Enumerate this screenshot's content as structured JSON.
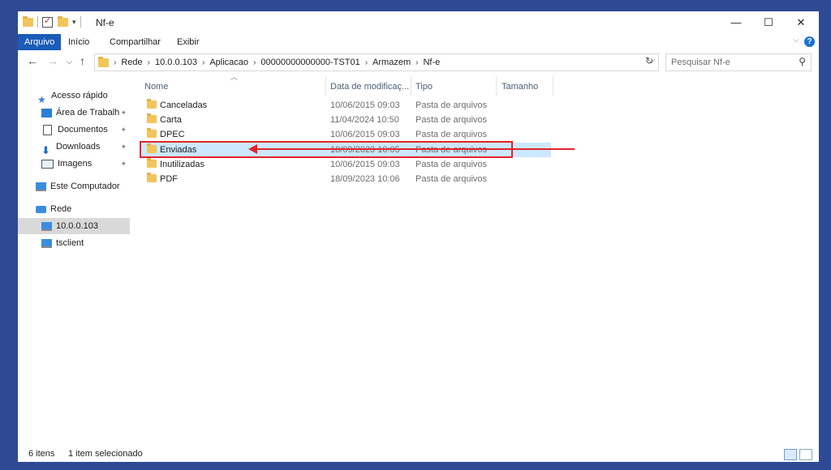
{
  "window": {
    "title": "Nf-e",
    "controls": {
      "minimize": "—",
      "maximize": "☐",
      "close": "✕"
    }
  },
  "ribbon": {
    "tabs": [
      "Arquivo",
      "Início",
      "Compartilhar",
      "Exibir"
    ]
  },
  "address": {
    "breadcrumbs": [
      "Rede",
      "10.0.0.103",
      "Aplicacao",
      "00000000000000-TST01",
      "Armazem",
      "Nf-e"
    ]
  },
  "search": {
    "placeholder": "Pesquisar Nf-e"
  },
  "sidebar": {
    "items": [
      {
        "label": "Acesso rápido",
        "icon": "star-icon"
      },
      {
        "label": "Área de Trabalho",
        "icon": "desktop-icon",
        "pinned": true
      },
      {
        "label": "Documentos",
        "icon": "document-icon",
        "pinned": true
      },
      {
        "label": "Downloads",
        "icon": "download-icon",
        "pinned": true
      },
      {
        "label": "Imagens",
        "icon": "image-icon",
        "pinned": true
      },
      {
        "label": "Este Computador",
        "icon": "computer-icon"
      },
      {
        "label": "Rede",
        "icon": "network-icon"
      },
      {
        "label": "10.0.0.103",
        "icon": "monitor-icon",
        "selected": true
      },
      {
        "label": "tsclient",
        "icon": "monitor-icon"
      }
    ]
  },
  "columns": [
    "Nome",
    "Data de modificaç...",
    "Tipo",
    "Tamanho"
  ],
  "files": [
    {
      "name": "Canceladas",
      "date": "10/06/2015 09:03",
      "type": "Pasta de arquivos"
    },
    {
      "name": "Carta",
      "date": "11/04/2024 10:50",
      "type": "Pasta de arquivos"
    },
    {
      "name": "DPEC",
      "date": "10/06/2015 09:03",
      "type": "Pasta de arquivos"
    },
    {
      "name": "Enviadas",
      "date": "18/09/2023 10:05",
      "type": "Pasta de arquivos",
      "selected": true
    },
    {
      "name": "Inutilizadas",
      "date": "10/06/2015 09:03",
      "type": "Pasta de arquivos"
    },
    {
      "name": "PDF",
      "date": "18/09/2023 10:06",
      "type": "Pasta de arquivos"
    }
  ],
  "status": {
    "count": "6 itens",
    "selection": "1 item selecionado"
  },
  "colors": {
    "accent": "#1a5cb8",
    "selection": "#cce8ff",
    "annotation": "#e3232c",
    "background": "#2e4a94"
  }
}
